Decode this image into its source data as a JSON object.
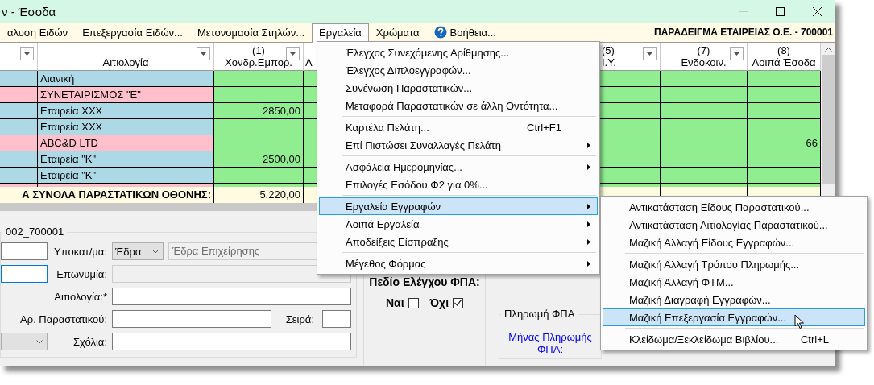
{
  "window": {
    "title": "ν - Έσοδα"
  },
  "menu_bar": {
    "items": [
      {
        "label": "αλυση Ειδών",
        "kind": "text",
        "selected": false
      },
      {
        "label": "Επεξεργασία Ειδών...",
        "kind": "text",
        "selected": false
      },
      {
        "label": "Μετονομασία Στηλών...",
        "kind": "text",
        "selected": false
      },
      {
        "label": "Εργαλεία",
        "kind": "text",
        "selected": true
      },
      {
        "label": "Χρώματα",
        "kind": "text",
        "selected": false
      },
      {
        "label": "Βοήθεια...",
        "kind": "help",
        "selected": false
      }
    ],
    "company": "ΠΑΡΑΔΕΙΓΜΑ ΕΤΑΙΡΕΙΑΣ Ο.Ε. - 700001"
  },
  "table": {
    "columns": [
      {
        "filter": true
      },
      {
        "title": "Αιτιολογία",
        "filter": true
      },
      {
        "number": "(1)",
        "title": "Χονδρ.Εμπορ.",
        "filter": true
      },
      {
        "title": "Λ",
        "filter": false
      },
      {
        "number": "(5)",
        "title": "Ι.Υ.",
        "filter": true
      },
      {
        "number": "(7)",
        "title": "Ενδοκοιν.",
        "filter": true
      },
      {
        "number": "(8)",
        "title": "Λοιπά Έσοδα",
        "filter": false
      }
    ],
    "rows": [
      {
        "reason": "Λιανική",
        "color": "#add8e6"
      },
      {
        "reason": "ΣΥΝΕΤΑΙΡΙΣΜΟΣ \"Ε\"",
        "color": "#ffc0cb"
      },
      {
        "reason": "Εταιρεία ΧΧΧ",
        "col_1": "2850,00",
        "color": "#add8e6"
      },
      {
        "reason": "Εταιρεία ΧΧΧ",
        "color": "#add8e6"
      },
      {
        "reason": "ABC&D LTD",
        "col_8": "66",
        "color": "#ffc0cb"
      },
      {
        "reason": "Εταιρεία \"Κ\"",
        "col_1": "2500,00",
        "color": "#add8e6"
      },
      {
        "reason": "Εταιρεία \"Κ\"",
        "color": "#add8e6"
      },
      {
        "color": "#ffc0cb"
      }
    ],
    "totals": {
      "label": "Α ΣΥΝΟΛΑ ΠΑΡΑΣΤΑΤΙΚΩΝ ΟΘΟΝΗΣ:",
      "col_1": "5.220,00"
    }
  },
  "form": {
    "group_title": "002_700001",
    "branch_label": "Υποκατ/μα:",
    "branch_select": "Έδρα",
    "branch_name": "Έδρα Επιχείρησης",
    "name_label": "Επωνυμία:",
    "reason_label": "Αιτιολογία:*",
    "doc_label": "Αρ. Παραστατικού:",
    "series_label": "Σειρά:",
    "comments_label": "Σχόλια:"
  },
  "vat_check": {
    "title": "Πεδίο Ελέγχου ΦΠΑ:",
    "options": [
      {
        "label": "Ναι",
        "checked": false
      },
      {
        "label": "Όχι",
        "checked": true
      }
    ]
  },
  "vat_payment": {
    "title": "Πληρωμή ΦΠΑ",
    "link": "Μήνας Πληρωμής ΦΠΑ:"
  },
  "tools_menu": {
    "items": [
      {
        "kind": "item",
        "label": "Έλεγχος Συνεχόμενης Αρίθμησης...",
        "submenu": false,
        "selected": false
      },
      {
        "kind": "item",
        "label": "Έλεγχος Διπλοεγγραφών...",
        "submenu": false,
        "selected": false
      },
      {
        "kind": "item",
        "label": "Συνένωση Παραστατικών...",
        "submenu": false,
        "selected": false
      },
      {
        "kind": "item",
        "label": "Μεταφορά Παραστατικών σε άλλη Οντότητα...",
        "submenu": false,
        "selected": false
      },
      {
        "kind": "separator"
      },
      {
        "kind": "item",
        "label": "Καρτέλα Πελάτη...",
        "shortcut": "Ctrl+F1",
        "submenu": false,
        "selected": false
      },
      {
        "kind": "item",
        "label": "Επί Πιστώσει Συναλλαγές Πελάτη",
        "submenu": true,
        "selected": false
      },
      {
        "kind": "separator"
      },
      {
        "kind": "item",
        "label": "Ασφάλεια Ημερομηνίας...",
        "submenu": true,
        "selected": false
      },
      {
        "kind": "item",
        "label": "Επιλογές Εσόδου Φ2 για 0%...",
        "submenu": false,
        "selected": false
      },
      {
        "kind": "separator"
      },
      {
        "kind": "item",
        "label": "Εργαλεία Εγγραφών",
        "submenu": true,
        "selected": true
      },
      {
        "kind": "item",
        "label": "Λοιπά Εργαλεία",
        "submenu": true,
        "selected": false
      },
      {
        "kind": "item",
        "label": "Αποδείξεις Είσπραξης",
        "submenu": true,
        "selected": false
      },
      {
        "kind": "separator"
      },
      {
        "kind": "item",
        "label": "Μέγεθος Φόρμας",
        "submenu": true,
        "selected": false
      }
    ]
  },
  "records_submenu": {
    "items": [
      {
        "kind": "item",
        "label": "Αντικατάσταση Είδους Παραστατικού...",
        "submenu": false,
        "selected": false
      },
      {
        "kind": "item",
        "label": "Αντικατάσταση Αιτιολογίας Παραστατικού...",
        "submenu": false,
        "selected": false
      },
      {
        "kind": "item",
        "label": "Μαζική Αλλαγή Είδους Εγγραφών...",
        "submenu": false,
        "selected": false
      },
      {
        "kind": "separator"
      },
      {
        "kind": "item",
        "label": "Μαζική Αλλαγή Τρόπου Πληρωμής...",
        "submenu": false,
        "selected": false
      },
      {
        "kind": "item",
        "label": "Μαζική Αλλαγή ΦΤΜ...",
        "submenu": false,
        "selected": false
      },
      {
        "kind": "item",
        "label": "Μαζική Διαγραφή Εγγραφών...",
        "submenu": false,
        "selected": false
      },
      {
        "kind": "item",
        "label": "Μαζική Επεξεργασία Εγγραφών...",
        "submenu": false,
        "selected": true
      },
      {
        "kind": "separator"
      },
      {
        "kind": "item",
        "label": "Κλείδωμα/Ξεκλείδωμα Βιβλίου...",
        "shortcut": "Ctrl+L",
        "submenu": false,
        "selected": false
      }
    ]
  }
}
